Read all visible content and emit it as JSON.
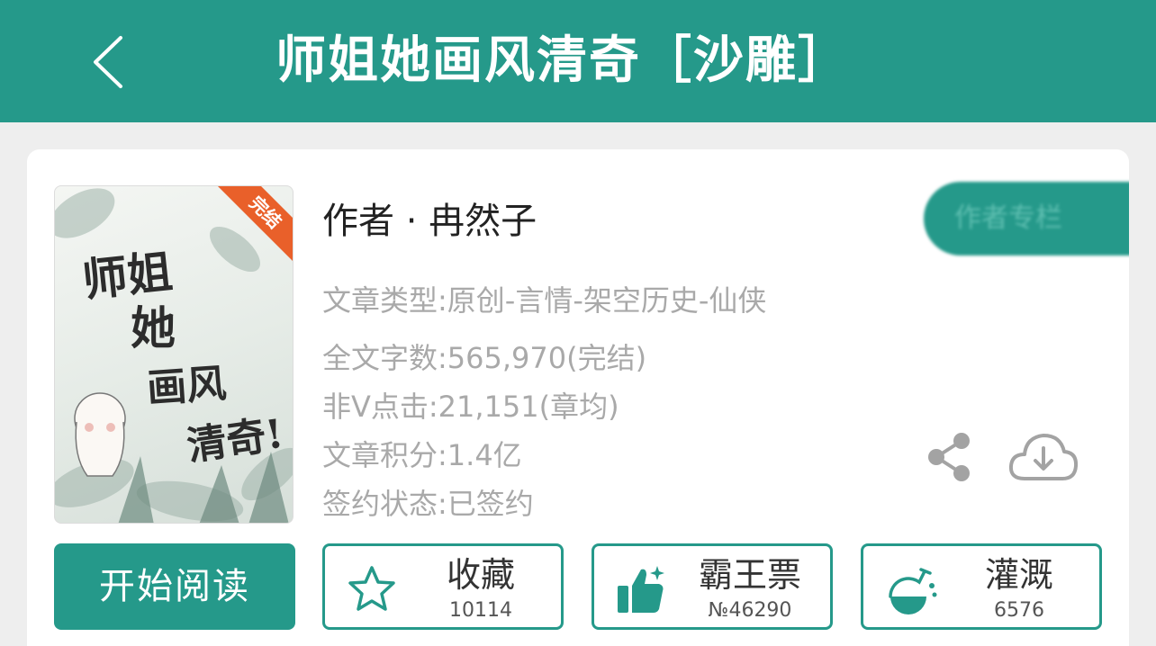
{
  "header": {
    "title": "师姐她画风清奇［沙雕］"
  },
  "book": {
    "cover": {
      "badge": "完结",
      "lines": [
        "师姐",
        "她",
        "画风",
        "清奇!"
      ]
    },
    "author": "作者 · 冉然子",
    "author_button_label": "作者专栏",
    "info": [
      "文章类型:原创-言情-架空历史-仙侠",
      "全文字数:565,970(完结)",
      "非V点击:21,151(章均)",
      "文章积分:1.4亿",
      "签约状态:已签约"
    ]
  },
  "actions": {
    "read_label": "开始阅读",
    "favorite": {
      "label": "收藏",
      "count": "10114"
    },
    "ticket": {
      "label": "霸王票",
      "count": "№46290"
    },
    "nutrient": {
      "label": "灌溉",
      "count": "6576"
    }
  },
  "colors": {
    "accent": "#25998a",
    "info_text": "#a9a9a9",
    "badge": "#e9602a"
  },
  "icons": [
    "back-arrow-icon",
    "share-icon",
    "cloud-download-icon",
    "star-icon",
    "thumbs-up-icon",
    "watering-flask-icon"
  ]
}
